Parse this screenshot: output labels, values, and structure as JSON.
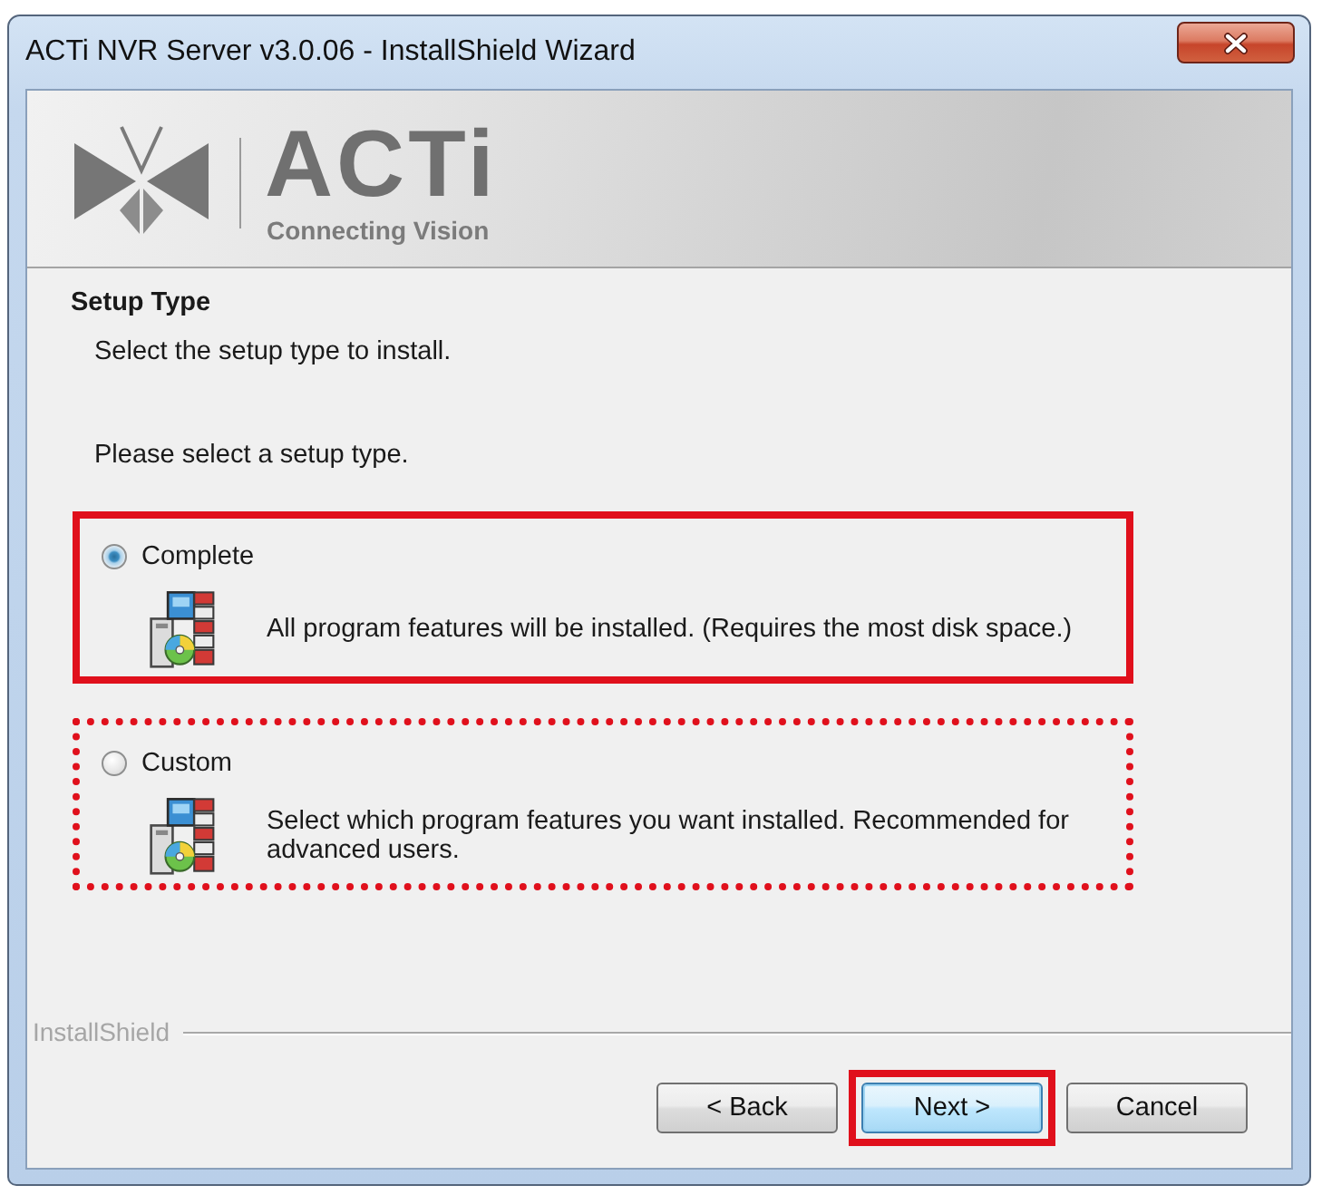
{
  "window": {
    "title": "ACTi NVR Server v3.0.06 - InstallShield Wizard"
  },
  "banner": {
    "brand": "ACTi",
    "tagline": "Connecting Vision"
  },
  "heading": "Setup Type",
  "subheading": "Select the setup type to install.",
  "prompt": "Please select a setup type.",
  "options": [
    {
      "label": "Complete",
      "description": "All program features will be installed. (Requires the most disk space.)",
      "selected": true,
      "kind": "solid"
    },
    {
      "label": "Custom",
      "description": "Select which program features you want installed. Recommended for advanced users.",
      "selected": false,
      "kind": "dotted"
    }
  ],
  "footer": {
    "label": "InstallShield"
  },
  "buttons": [
    {
      "label": "< Back",
      "focused": false,
      "highlighted": false
    },
    {
      "label": "Next >",
      "focused": true,
      "highlighted": true
    },
    {
      "label": "Cancel",
      "focused": false,
      "highlighted": false
    }
  ]
}
